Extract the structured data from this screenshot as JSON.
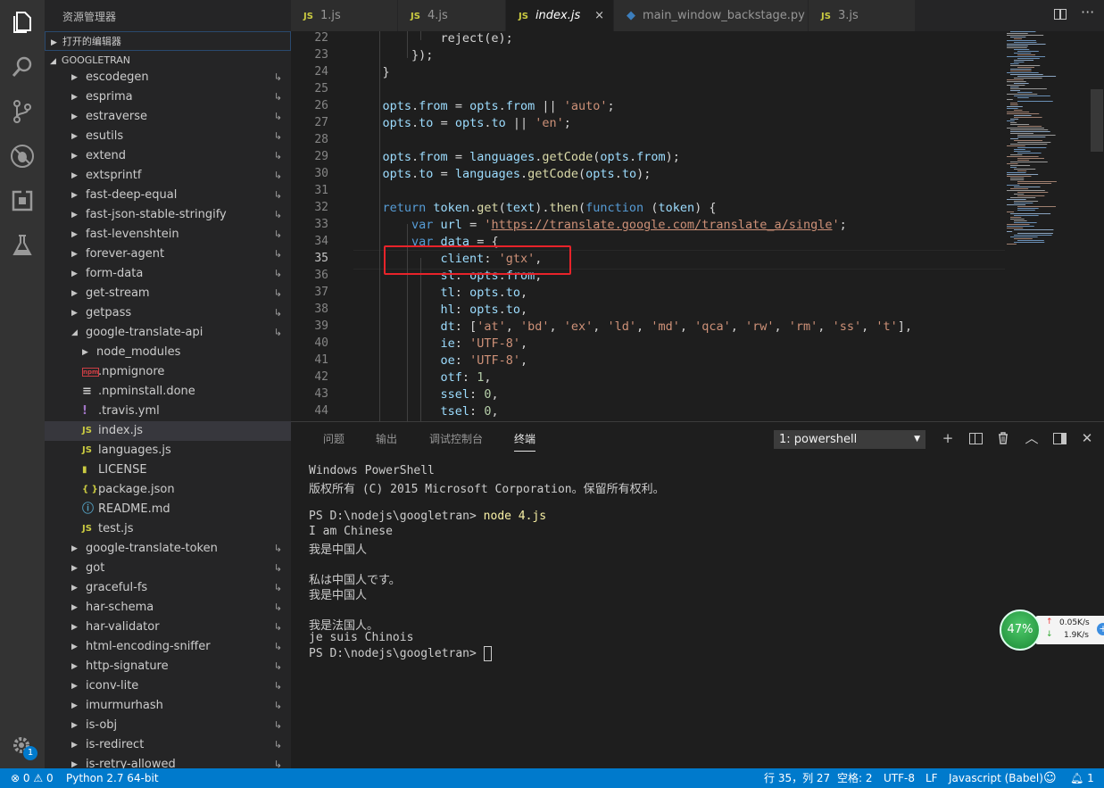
{
  "sidebar": {
    "title": "资源管理器",
    "open_editors": "打开的编辑器",
    "project": "GOOGLETRAN",
    "items": [
      {
        "label": "escodegen",
        "kind": "folder",
        "depth": 0,
        "link": true
      },
      {
        "label": "esprima",
        "kind": "folder",
        "depth": 0,
        "link": true
      },
      {
        "label": "estraverse",
        "kind": "folder",
        "depth": 0,
        "link": true
      },
      {
        "label": "esutils",
        "kind": "folder",
        "depth": 0,
        "link": true
      },
      {
        "label": "extend",
        "kind": "folder",
        "depth": 0,
        "link": true
      },
      {
        "label": "extsprintf",
        "kind": "folder",
        "depth": 0,
        "link": true
      },
      {
        "label": "fast-deep-equal",
        "kind": "folder",
        "depth": 0,
        "link": true
      },
      {
        "label": "fast-json-stable-stringify",
        "kind": "folder",
        "depth": 0,
        "link": true
      },
      {
        "label": "fast-levenshtein",
        "kind": "folder",
        "depth": 0,
        "link": true
      },
      {
        "label": "forever-agent",
        "kind": "folder",
        "depth": 0,
        "link": true
      },
      {
        "label": "form-data",
        "kind": "folder",
        "depth": 0,
        "link": true
      },
      {
        "label": "get-stream",
        "kind": "folder",
        "depth": 0,
        "link": true
      },
      {
        "label": "getpass",
        "kind": "folder",
        "depth": 0,
        "link": true
      },
      {
        "label": "google-translate-api",
        "kind": "folder-open",
        "depth": 0,
        "link": true
      },
      {
        "label": "node_modules",
        "kind": "folder",
        "depth": 1,
        "link": false
      },
      {
        "label": ".npmignore",
        "kind": "npm",
        "depth": 1,
        "link": false
      },
      {
        "label": ".npminstall.done",
        "kind": "lines",
        "depth": 1,
        "link": false
      },
      {
        "label": ".travis.yml",
        "kind": "yml",
        "depth": 1,
        "link": false
      },
      {
        "label": "index.js",
        "kind": "js",
        "depth": 1,
        "link": false,
        "selected": true
      },
      {
        "label": "languages.js",
        "kind": "js",
        "depth": 1,
        "link": false
      },
      {
        "label": "LICENSE",
        "kind": "license",
        "depth": 1,
        "link": false
      },
      {
        "label": "package.json",
        "kind": "json",
        "depth": 1,
        "link": false
      },
      {
        "label": "README.md",
        "kind": "info",
        "depth": 1,
        "link": false
      },
      {
        "label": "test.js",
        "kind": "js",
        "depth": 1,
        "link": false
      },
      {
        "label": "google-translate-token",
        "kind": "folder",
        "depth": 0,
        "link": true
      },
      {
        "label": "got",
        "kind": "folder",
        "depth": 0,
        "link": true
      },
      {
        "label": "graceful-fs",
        "kind": "folder",
        "depth": 0,
        "link": true
      },
      {
        "label": "har-schema",
        "kind": "folder",
        "depth": 0,
        "link": true
      },
      {
        "label": "har-validator",
        "kind": "folder",
        "depth": 0,
        "link": true
      },
      {
        "label": "html-encoding-sniffer",
        "kind": "folder",
        "depth": 0,
        "link": true
      },
      {
        "label": "http-signature",
        "kind": "folder",
        "depth": 0,
        "link": true
      },
      {
        "label": "iconv-lite",
        "kind": "folder",
        "depth": 0,
        "link": true
      },
      {
        "label": "imurmurhash",
        "kind": "folder",
        "depth": 0,
        "link": true
      },
      {
        "label": "is-obj",
        "kind": "folder",
        "depth": 0,
        "link": true
      },
      {
        "label": "is-redirect",
        "kind": "folder",
        "depth": 0,
        "link": true
      },
      {
        "label": "is-retry-allowed",
        "kind": "folder",
        "depth": 0,
        "link": true
      }
    ]
  },
  "activity": {
    "settings_badge": "1"
  },
  "tabs": [
    {
      "label": "1.js",
      "icon": "JS"
    },
    {
      "label": "4.js",
      "icon": "JS"
    },
    {
      "label": "index.js",
      "icon": "JS",
      "active": true
    },
    {
      "label": "main_window_backstage.py",
      "icon": "PY"
    },
    {
      "label": "3.js",
      "icon": "JS"
    }
  ],
  "tab_close": "×",
  "editor": {
    "line_numbers": [
      "22",
      "23",
      "24",
      "25",
      "26",
      "27",
      "28",
      "29",
      "30",
      "31",
      "32",
      "33",
      "34",
      "35",
      "36",
      "37",
      "38",
      "39",
      "40",
      "41",
      "42",
      "43",
      "44"
    ],
    "lines": [
      [
        {
          "t": "            reject(e);",
          "c": ""
        }
      ],
      [
        {
          "t": "        });",
          "c": ""
        }
      ],
      [
        {
          "t": "    }",
          "c": ""
        }
      ],
      [
        {
          "t": "",
          "c": ""
        }
      ],
      [
        {
          "t": "    opts",
          "c": "var"
        },
        {
          "t": ".",
          "c": ""
        },
        {
          "t": "from",
          "c": "var"
        },
        {
          "t": " = ",
          "c": ""
        },
        {
          "t": "opts",
          "c": "var"
        },
        {
          "t": ".",
          "c": ""
        },
        {
          "t": "from",
          "c": "var"
        },
        {
          "t": " || ",
          "c": ""
        },
        {
          "t": "'auto'",
          "c": "str"
        },
        {
          "t": ";",
          "c": ""
        }
      ],
      [
        {
          "t": "    opts",
          "c": "var"
        },
        {
          "t": ".",
          "c": ""
        },
        {
          "t": "to",
          "c": "var"
        },
        {
          "t": " = ",
          "c": ""
        },
        {
          "t": "opts",
          "c": "var"
        },
        {
          "t": ".",
          "c": ""
        },
        {
          "t": "to",
          "c": "var"
        },
        {
          "t": " || ",
          "c": ""
        },
        {
          "t": "'en'",
          "c": "str"
        },
        {
          "t": ";",
          "c": ""
        }
      ],
      [
        {
          "t": "",
          "c": ""
        }
      ],
      [
        {
          "t": "    opts",
          "c": "var"
        },
        {
          "t": ".",
          "c": ""
        },
        {
          "t": "from",
          "c": "var"
        },
        {
          "t": " = ",
          "c": ""
        },
        {
          "t": "languages",
          "c": "var"
        },
        {
          "t": ".",
          "c": ""
        },
        {
          "t": "getCode",
          "c": "fn"
        },
        {
          "t": "(",
          "c": ""
        },
        {
          "t": "opts",
          "c": "var"
        },
        {
          "t": ".",
          "c": ""
        },
        {
          "t": "from",
          "c": "var"
        },
        {
          "t": ");",
          "c": ""
        }
      ],
      [
        {
          "t": "    opts",
          "c": "var"
        },
        {
          "t": ".",
          "c": ""
        },
        {
          "t": "to",
          "c": "var"
        },
        {
          "t": " = ",
          "c": ""
        },
        {
          "t": "languages",
          "c": "var"
        },
        {
          "t": ".",
          "c": ""
        },
        {
          "t": "getCode",
          "c": "fn"
        },
        {
          "t": "(",
          "c": ""
        },
        {
          "t": "opts",
          "c": "var"
        },
        {
          "t": ".",
          "c": ""
        },
        {
          "t": "to",
          "c": "var"
        },
        {
          "t": ");",
          "c": ""
        }
      ],
      [
        {
          "t": "",
          "c": ""
        }
      ],
      [
        {
          "t": "    return ",
          "c": "kw"
        },
        {
          "t": "token",
          "c": "var"
        },
        {
          "t": ".",
          "c": ""
        },
        {
          "t": "get",
          "c": "fn"
        },
        {
          "t": "(",
          "c": ""
        },
        {
          "t": "text",
          "c": "var"
        },
        {
          "t": ").",
          "c": ""
        },
        {
          "t": "then",
          "c": "fn"
        },
        {
          "t": "(",
          "c": ""
        },
        {
          "t": "function",
          "c": "kw"
        },
        {
          "t": " (",
          "c": ""
        },
        {
          "t": "token",
          "c": "var"
        },
        {
          "t": ") {",
          "c": ""
        }
      ],
      [
        {
          "t": "        var ",
          "c": "kw"
        },
        {
          "t": "url",
          "c": "var"
        },
        {
          "t": " = ",
          "c": ""
        },
        {
          "t": "'",
          "c": "str"
        },
        {
          "t": "https://translate.google.com/translate_a/single",
          "c": "url"
        },
        {
          "t": "'",
          "c": "str"
        },
        {
          "t": ";",
          "c": ""
        }
      ],
      [
        {
          "t": "        var ",
          "c": "kw"
        },
        {
          "t": "data",
          "c": "var"
        },
        {
          "t": " = {",
          "c": ""
        }
      ],
      [
        {
          "t": "            client",
          "c": "var"
        },
        {
          "t": ": ",
          "c": ""
        },
        {
          "t": "'gtx'",
          "c": "str"
        },
        {
          "t": ",",
          "c": ""
        }
      ],
      [
        {
          "t": "            sl",
          "c": "var"
        },
        {
          "t": ": ",
          "c": ""
        },
        {
          "t": "opts",
          "c": "var"
        },
        {
          "t": ".",
          "c": ""
        },
        {
          "t": "from",
          "c": "var"
        },
        {
          "t": ",",
          "c": ""
        }
      ],
      [
        {
          "t": "            tl",
          "c": "var"
        },
        {
          "t": ": ",
          "c": ""
        },
        {
          "t": "opts",
          "c": "var"
        },
        {
          "t": ".",
          "c": ""
        },
        {
          "t": "to",
          "c": "var"
        },
        {
          "t": ",",
          "c": ""
        }
      ],
      [
        {
          "t": "            hl",
          "c": "var"
        },
        {
          "t": ": ",
          "c": ""
        },
        {
          "t": "opts",
          "c": "var"
        },
        {
          "t": ".",
          "c": ""
        },
        {
          "t": "to",
          "c": "var"
        },
        {
          "t": ",",
          "c": ""
        }
      ],
      [
        {
          "t": "            dt",
          "c": "var"
        },
        {
          "t": ": [",
          "c": ""
        },
        {
          "t": "'at'",
          "c": "str"
        },
        {
          "t": ", ",
          "c": ""
        },
        {
          "t": "'bd'",
          "c": "str"
        },
        {
          "t": ", ",
          "c": ""
        },
        {
          "t": "'ex'",
          "c": "str"
        },
        {
          "t": ", ",
          "c": ""
        },
        {
          "t": "'ld'",
          "c": "str"
        },
        {
          "t": ", ",
          "c": ""
        },
        {
          "t": "'md'",
          "c": "str"
        },
        {
          "t": ", ",
          "c": ""
        },
        {
          "t": "'qca'",
          "c": "str"
        },
        {
          "t": ", ",
          "c": ""
        },
        {
          "t": "'rw'",
          "c": "str"
        },
        {
          "t": ", ",
          "c": ""
        },
        {
          "t": "'rm'",
          "c": "str"
        },
        {
          "t": ", ",
          "c": ""
        },
        {
          "t": "'ss'",
          "c": "str"
        },
        {
          "t": ", ",
          "c": ""
        },
        {
          "t": "'t'",
          "c": "str"
        },
        {
          "t": "],",
          "c": ""
        }
      ],
      [
        {
          "t": "            ie",
          "c": "var"
        },
        {
          "t": ": ",
          "c": ""
        },
        {
          "t": "'UTF-8'",
          "c": "str"
        },
        {
          "t": ",",
          "c": ""
        }
      ],
      [
        {
          "t": "            oe",
          "c": "var"
        },
        {
          "t": ": ",
          "c": ""
        },
        {
          "t": "'UTF-8'",
          "c": "str"
        },
        {
          "t": ",",
          "c": ""
        }
      ],
      [
        {
          "t": "            otf",
          "c": "var"
        },
        {
          "t": ": ",
          "c": ""
        },
        {
          "t": "1",
          "c": "num"
        },
        {
          "t": ",",
          "c": ""
        }
      ],
      [
        {
          "t": "            ssel",
          "c": "var"
        },
        {
          "t": ": ",
          "c": ""
        },
        {
          "t": "0",
          "c": "num"
        },
        {
          "t": ",",
          "c": ""
        }
      ],
      [
        {
          "t": "            tsel",
          "c": "var"
        },
        {
          "t": ": ",
          "c": ""
        },
        {
          "t": "0",
          "c": "num"
        },
        {
          "t": ",",
          "c": ""
        }
      ]
    ]
  },
  "panel": {
    "tabs": [
      "问题",
      "输出",
      "调试控制台",
      "终端"
    ],
    "active_tab": "终端",
    "terminal_select": "1: powershell",
    "terminal_lines": [
      {
        "text": "Windows PowerShell"
      },
      {
        "text": "版权所有 (C) 2015 Microsoft Corporation。保留所有权利。"
      },
      {
        "text": ""
      },
      {
        "text": "PS D:\\nodejs\\googletran> ",
        "cmd": "node 4.js"
      },
      {
        "text": "I am Chinese"
      },
      {
        "text": "我是中国人"
      },
      {
        "text": ""
      },
      {
        "text": "私は中国人です。"
      },
      {
        "text": "我是中国人"
      },
      {
        "text": ""
      },
      {
        "text": "我是法国人。"
      },
      {
        "text": "je suis Chinois"
      },
      {
        "text": "PS D:\\nodejs\\googletran> ",
        "cursor": true
      }
    ]
  },
  "widget": {
    "percent": "47%",
    "up": "0.05K/s",
    "down": "1.9K/s"
  },
  "status": {
    "errors": "0",
    "warnings": "0",
    "python": "Python 2.7 64-bit",
    "position": "行 35，列 27",
    "spaces": "空格: 2",
    "encoding": "UTF-8",
    "eol": "LF",
    "language": "Javascript (Babel)",
    "bell_count": "1"
  }
}
